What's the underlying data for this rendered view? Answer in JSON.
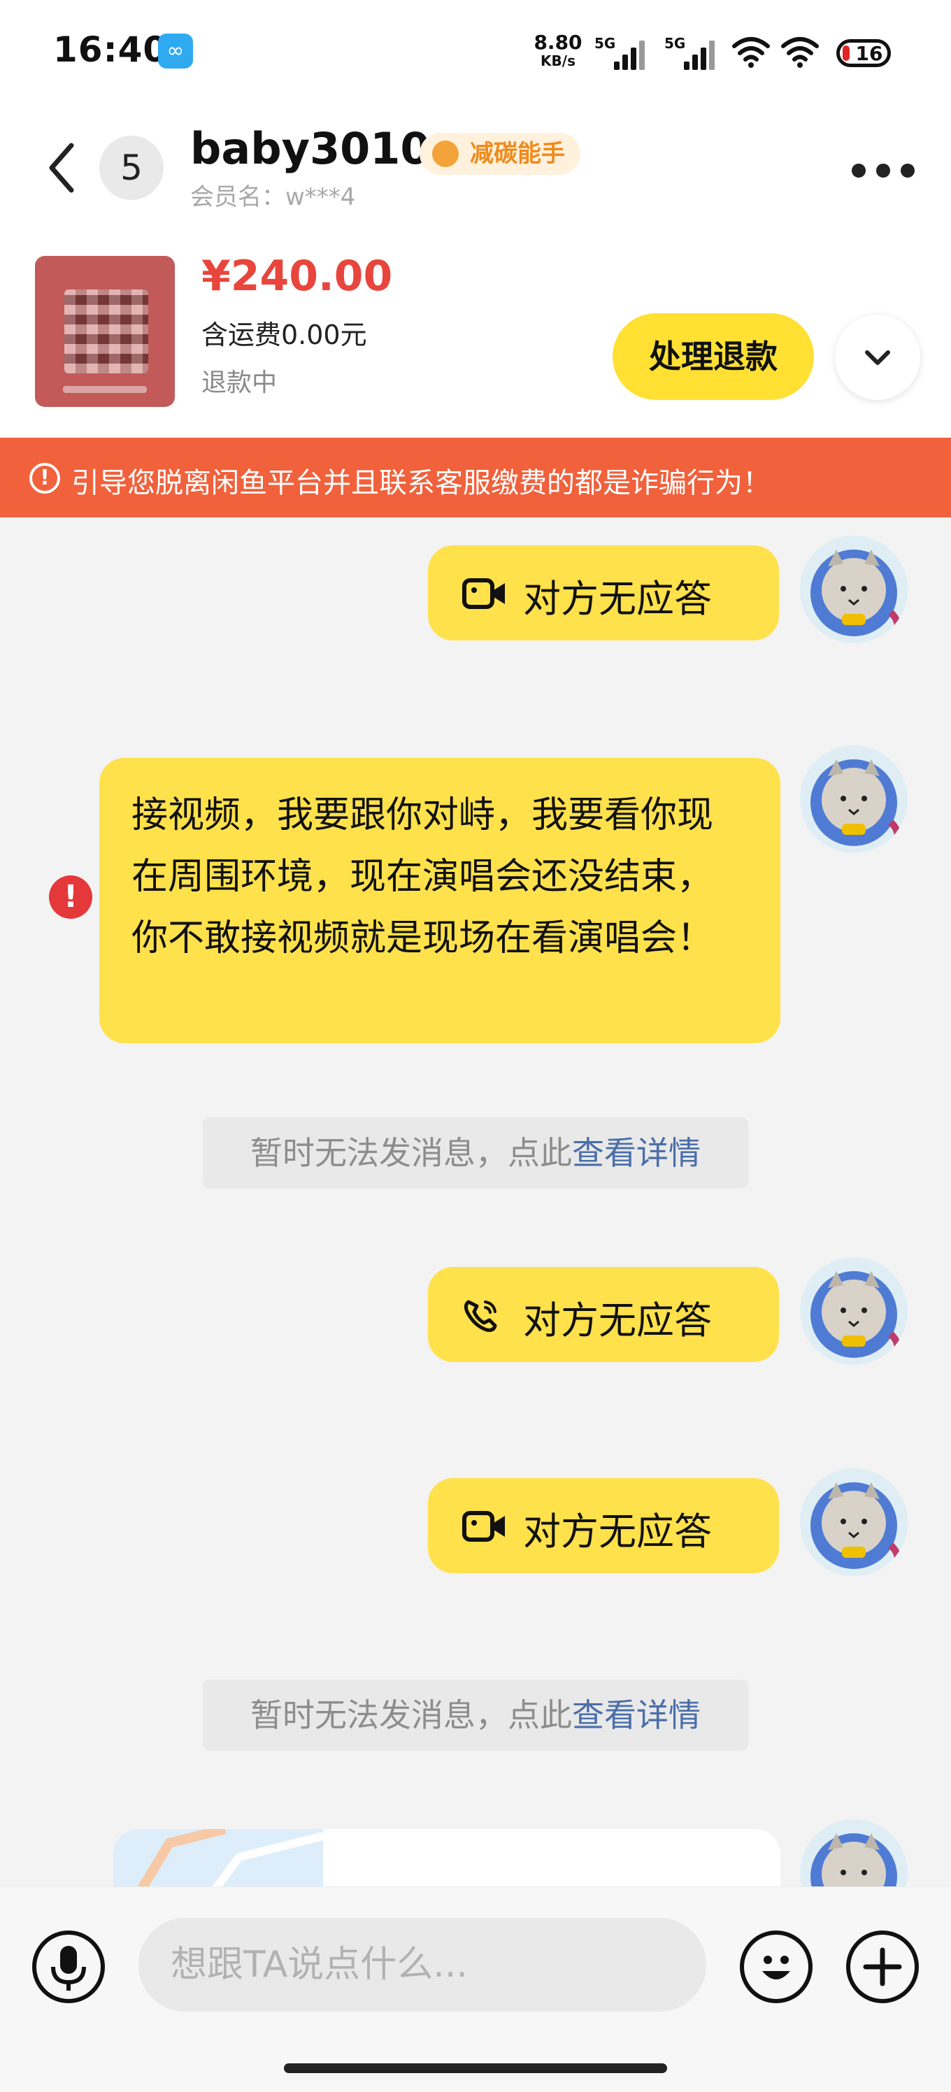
{
  "status_bar": {
    "time": "16:40",
    "net_speed_value": "8.80",
    "net_speed_unit": "KB/s",
    "sim1": "5G",
    "sim2": "5G",
    "battery": "16"
  },
  "header": {
    "unread_count": "5",
    "name": "baby3010",
    "badge": "减碳能手",
    "member": "会员名：w***4"
  },
  "product": {
    "price": "¥240.00",
    "shipping": "含运费0.00元",
    "status": "退款中",
    "refund_button": "处理退款"
  },
  "warning": {
    "text": "引导您脱离闲鱼平台并且联系客服缴费的都是诈骗行为！"
  },
  "messages": {
    "m1": {
      "type": "video-call",
      "label": "对方无应答"
    },
    "m2": {
      "type": "text",
      "text": "接视频，我要跟你对峙，我要看你现在周围环境，现在演唱会还没结束，你不敢接视频就是现场在看演唱会！",
      "error_mark": "!"
    },
    "n1": {
      "text": "暂时无法发消息，点此",
      "link": "查看详情"
    },
    "m3": {
      "type": "voice-call",
      "label": "对方无应答"
    },
    "m4": {
      "type": "video-call",
      "label": "对方无应答"
    },
    "n2": {
      "text": "暂时无法发消息，点此",
      "link": "查看详情"
    }
  },
  "input": {
    "placeholder": "想跟TA说点什么..."
  },
  "colors": {
    "accent_yellow": "#ffe14b",
    "price_red": "#e8453c",
    "warning_orange": "#f0613c",
    "link_blue": "#4a6ea8"
  },
  "icons": [
    "back-icon",
    "more-icon",
    "chevron-down-icon",
    "warning-icon",
    "video-call-icon",
    "phone-call-icon",
    "error-icon",
    "microphone-icon",
    "emoji-icon",
    "plus-icon"
  ]
}
